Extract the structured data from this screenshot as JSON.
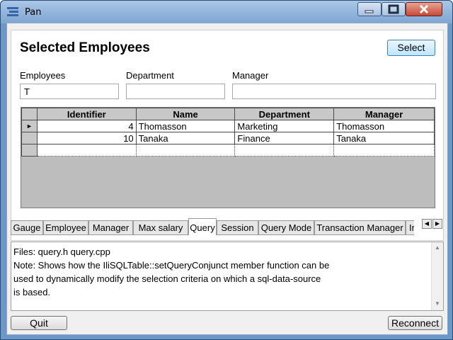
{
  "window": {
    "title": "Pan",
    "icons": [
      "app-icon",
      "minimize-icon",
      "maximize-icon",
      "close-icon"
    ]
  },
  "panel": {
    "heading": "Selected Employees",
    "select_label": "Select"
  },
  "filters": {
    "employees": {
      "label": "Employees",
      "value": "T"
    },
    "department": {
      "label": "Department",
      "value": ""
    },
    "manager": {
      "label": "Manager",
      "value": ""
    }
  },
  "grid": {
    "columns": [
      "Identifier",
      "Name",
      "Department",
      "Manager"
    ],
    "rows": [
      {
        "id": "4",
        "name": "Thomasson",
        "department": "Marketing",
        "manager": "Thomasson"
      },
      {
        "id": "10",
        "name": "Tanaka",
        "department": "Finance",
        "manager": "Tanaka"
      }
    ]
  },
  "tabs": {
    "items": [
      "Gauge",
      "Employee",
      "Manager",
      "Max salary",
      "Query",
      "Session",
      "Query Mode",
      "Transaction Manager",
      "Ins"
    ],
    "active": "Query"
  },
  "description": {
    "text": "Files: query.h query.cpp\nNote: Shows how the IliSQLTable::setQueryConjunct member function can be\nused to dynamically modify the selection criteria on which a sql-data-source\nis based."
  },
  "footer": {
    "quit_label": "Quit",
    "reconnect_label": "Reconnect"
  },
  "colors": {
    "titlebar": "#7fa6d2",
    "select_button": "#bee6fd",
    "close_button": "#c44a35"
  }
}
